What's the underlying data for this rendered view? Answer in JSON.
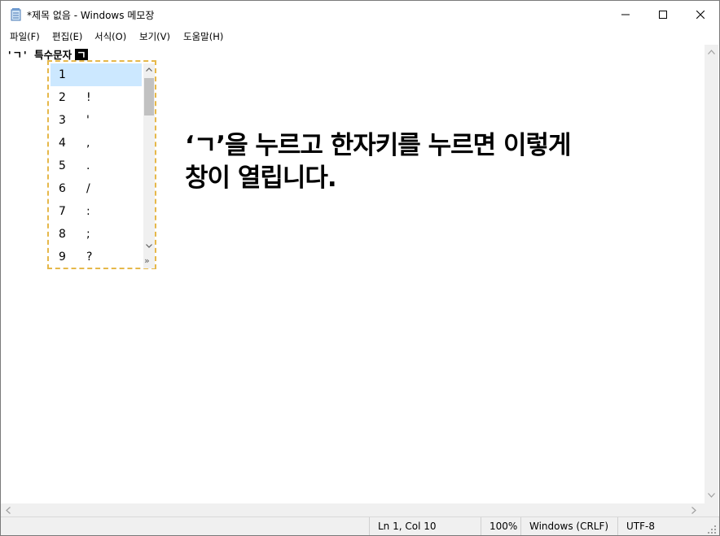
{
  "window": {
    "title": "*제목 없음 - Windows 메모장"
  },
  "menu": [
    "파일(F)",
    "편집(E)",
    "서식(O)",
    "보기(V)",
    "도움말(H)"
  ],
  "editor": {
    "text": "'ㄱ' 특수문자",
    "composing_char": "ㄱ"
  },
  "ime": {
    "candidates": [
      {
        "num": "1",
        "char": ""
      },
      {
        "num": "2",
        "char": "!"
      },
      {
        "num": "3",
        "char": "'"
      },
      {
        "num": "4",
        "char": ","
      },
      {
        "num": "5",
        "char": "."
      },
      {
        "num": "6",
        "char": "/"
      },
      {
        "num": "7",
        "char": ":"
      },
      {
        "num": "8",
        "char": ";"
      },
      {
        "num": "9",
        "char": "?"
      }
    ],
    "selected_index": 0,
    "more_symbol": "»"
  },
  "annotation": {
    "line1": "‘ㄱ’을 누르고 한자키를 누르면 이렇게",
    "line2": "창이 열립니다."
  },
  "status": {
    "position": "Ln 1, Col 10",
    "zoom": "100%",
    "line_ending": "Windows (CRLF)",
    "encoding": "UTF-8"
  }
}
